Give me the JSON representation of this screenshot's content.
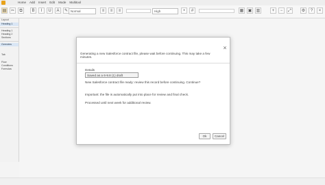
{
  "menubar": {
    "items": [
      "Home",
      "Add",
      "Insert",
      "Edit",
      "Mode",
      "Multitool"
    ]
  },
  "toolbar": {
    "font_select": "Normal",
    "size_select": "High",
    "colors": {
      "app_icon": "#e8a21a"
    }
  },
  "sidebar": {
    "header": "Layout",
    "selected": "Heading 1",
    "items": [
      "Heading 1",
      "Heading 2",
      "Sections",
      "Overview"
    ],
    "lower_items": [
      "Tab",
      "Flow",
      "Conditions",
      "Formulas"
    ]
  },
  "dialog": {
    "header": "Generating a new Salesforce contract file, please wait before continuing. This may take a few minutes.",
    "label": "Details",
    "field_value": "Saved as a 6-9.8 (1) draft",
    "paragraph1": "New Salesforce contract file ready: review this record before continuing. Continue?",
    "paragraph2": "Important: the file is automatically put into place for review and final check.",
    "paragraph3": "Processed until next week for additional review.",
    "ok_label": "Ok",
    "cancel_label": "Cancel"
  }
}
